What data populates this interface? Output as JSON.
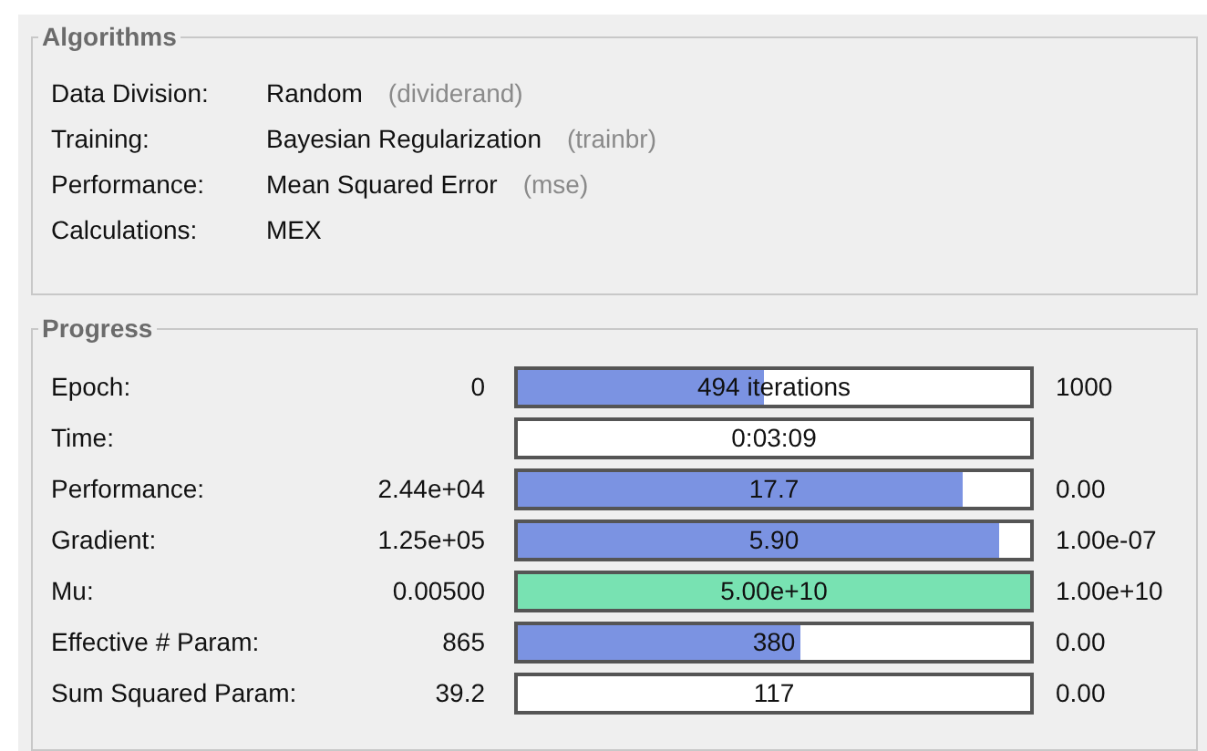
{
  "algorithms": {
    "title": "Algorithms",
    "rows": [
      {
        "label": "Data Division:",
        "value": "Random",
        "note": "(dividerand)"
      },
      {
        "label": "Training:",
        "value": "Bayesian Regularization",
        "note": "(trainbr)"
      },
      {
        "label": "Performance:",
        "value": "Mean Squared Error",
        "note": "(mse)"
      },
      {
        "label": "Calculations:",
        "value": "MEX"
      }
    ]
  },
  "progress": {
    "title": "Progress",
    "rows": [
      {
        "kind": "bar",
        "label": "Epoch:",
        "start": "0",
        "bar_text": "494 iterations",
        "level": 0.48,
        "color": "#7b93e2",
        "end": "1000"
      },
      {
        "kind": "box",
        "label": "Time:",
        "bar_text": "0:03:09"
      },
      {
        "kind": "bar",
        "label": "Performance:",
        "start": "2.44e+04",
        "bar_text": "17.7",
        "level": 0.87,
        "color": "#7b93e2",
        "end": "0.00"
      },
      {
        "kind": "bar",
        "label": "Gradient:",
        "start": "1.25e+05",
        "bar_text": "5.90",
        "level": 0.94,
        "color": "#7b93e2",
        "end": "1.00e-07"
      },
      {
        "kind": "bar",
        "label": "Mu:",
        "start": "0.00500",
        "bar_text": "5.00e+10",
        "level": 1,
        "color": "#78e2b2",
        "end": "1.00e+10"
      },
      {
        "kind": "bar",
        "label": "Effective # Param:",
        "start": "865",
        "bar_text": "380",
        "level": 0.55,
        "color": "#7b93e2",
        "end": "0.00"
      },
      {
        "kind": "box",
        "label": "Sum Squared Param:",
        "start": "39.2",
        "bar_text": "117",
        "end": "0.00"
      }
    ]
  }
}
